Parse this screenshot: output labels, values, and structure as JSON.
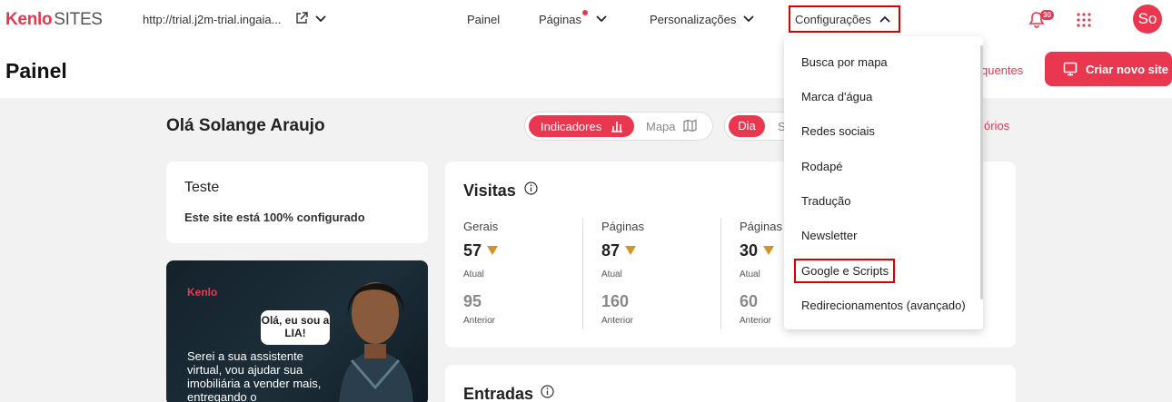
{
  "topbar": {
    "logo_brand": "Kenlo",
    "logo_sites": "SITES",
    "url": "http://trial.j2m-trial.ingaia...",
    "nav": {
      "painel": "Painel",
      "paginas": "Páginas",
      "personalizacoes": "Personalizações",
      "configuracoes": "Configurações"
    },
    "notification_count": "30",
    "avatar_initials": "So"
  },
  "header": {
    "title": "Painel",
    "frequentes_link": "quentes",
    "create_button": "Criar novo site"
  },
  "main": {
    "greeting": "Olá Solange Araujo",
    "view_toggle": {
      "active": "Indicadores",
      "inactive": "Mapa"
    },
    "period_toggle": {
      "active": "Dia",
      "next": "S"
    },
    "relatorios_link": "órios",
    "site_card": {
      "title": "Teste",
      "status": "Este site está 100% configurado"
    },
    "promo": {
      "logo": "Kenlo",
      "bubble": "Olá, eu sou a LIA!",
      "text": "Serei a sua assistente virtual, vou ajudar sua imobiliária a vender mais, entregando o"
    },
    "visitas": {
      "title": "Visitas",
      "metrics": [
        {
          "label": "Gerais",
          "current": "57",
          "current_label": "Atual",
          "previous": "95",
          "previous_label": "Anterior"
        },
        {
          "label": "Páginas",
          "current": "87",
          "current_label": "Atual",
          "previous": "160",
          "previous_label": "Anterior"
        },
        {
          "label": "Páginas c",
          "current": "30",
          "current_label": "Atual",
          "previous": "60",
          "previous_label": "Anterior"
        }
      ]
    },
    "entradas": {
      "title": "Entradas"
    }
  },
  "dropdown": {
    "items": [
      "Busca por mapa",
      "Marca d'água",
      "Redes sociais",
      "Rodapé",
      "Tradução",
      "Newsletter",
      "Google e Scripts",
      "Redirecionamentos (avançado)"
    ]
  },
  "colors": {
    "accent": "#e8374f",
    "highlight_border": "#d90000",
    "trend_down": "#d4941f"
  }
}
